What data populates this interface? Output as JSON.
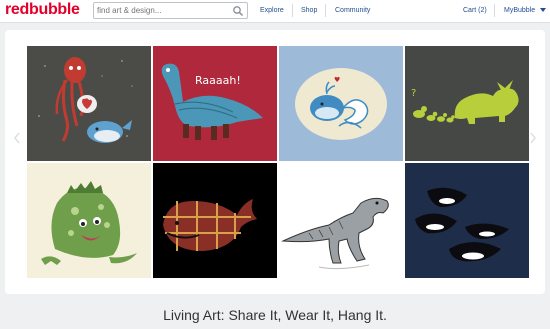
{
  "header": {
    "logo": {
      "part1": "red",
      "part2": "bubble"
    },
    "search": {
      "placeholder": "find art & design..."
    },
    "nav": {
      "explore": "Explore",
      "shop": "Shop",
      "community": "Community"
    },
    "account": {
      "cart": "Cart (2)",
      "mybubble": "MyBubble",
      "dropdown_icon": "chevron-down-icon"
    }
  },
  "hero": {
    "tiles": [
      {
        "name": "squid-whale-heart-art",
        "bg": "#4b4b47"
      },
      {
        "name": "raaaah-dinosaur-art",
        "bg": "#b0283b"
      },
      {
        "name": "whale-wave-art",
        "bg": "#9dbbd9"
      },
      {
        "name": "triceratops-ducks-art",
        "bg": "#454845"
      },
      {
        "name": "green-monster-art",
        "bg": "#f4f0dc"
      },
      {
        "name": "plaid-whale-art",
        "bg": "#000000"
      },
      {
        "name": "trex-sketch-art",
        "bg": "#ffffff"
      },
      {
        "name": "orcas-art",
        "bg": "#1e2d49"
      }
    ],
    "dino_text": "Raaaah!"
  },
  "tagline": "Living Art: Share It, Wear It, Hang It."
}
